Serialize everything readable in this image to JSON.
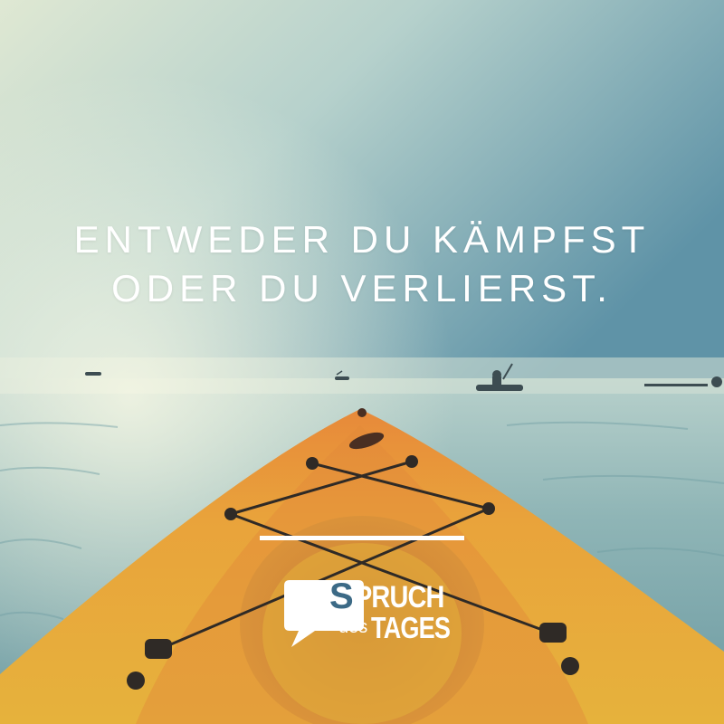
{
  "quote": {
    "line1": "ENTWEDER DU KÄMPFST",
    "line2": "ODER DU VERLIERST."
  },
  "logo": {
    "letter": "S",
    "word1_rest": "PRUCH",
    "word2": "des",
    "word3": "TAGES",
    "icon": "speech-bubble-icon"
  },
  "colors": {
    "text": "#ffffff",
    "kayak": "#e8a93a",
    "water": "#8fb4b8",
    "sky": "#b9d3cf"
  }
}
